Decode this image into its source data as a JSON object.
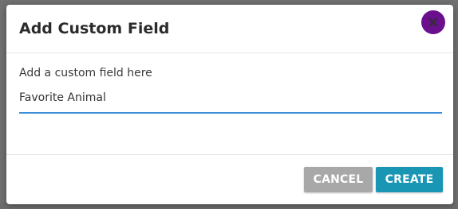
{
  "modal": {
    "title": "Add Custom Field",
    "close_icon": "close-icon",
    "field_label": "Add a custom field here",
    "field_value": "Favorite Animal",
    "cancel_label": "CANCEL",
    "create_label": "CREATE"
  },
  "colors": {
    "close_button_bg": "#6a0f8e",
    "input_underline": "#3a8fd8",
    "cancel_bg": "#a8a8a8",
    "create_bg": "#1896b4",
    "overlay": "#707070"
  }
}
